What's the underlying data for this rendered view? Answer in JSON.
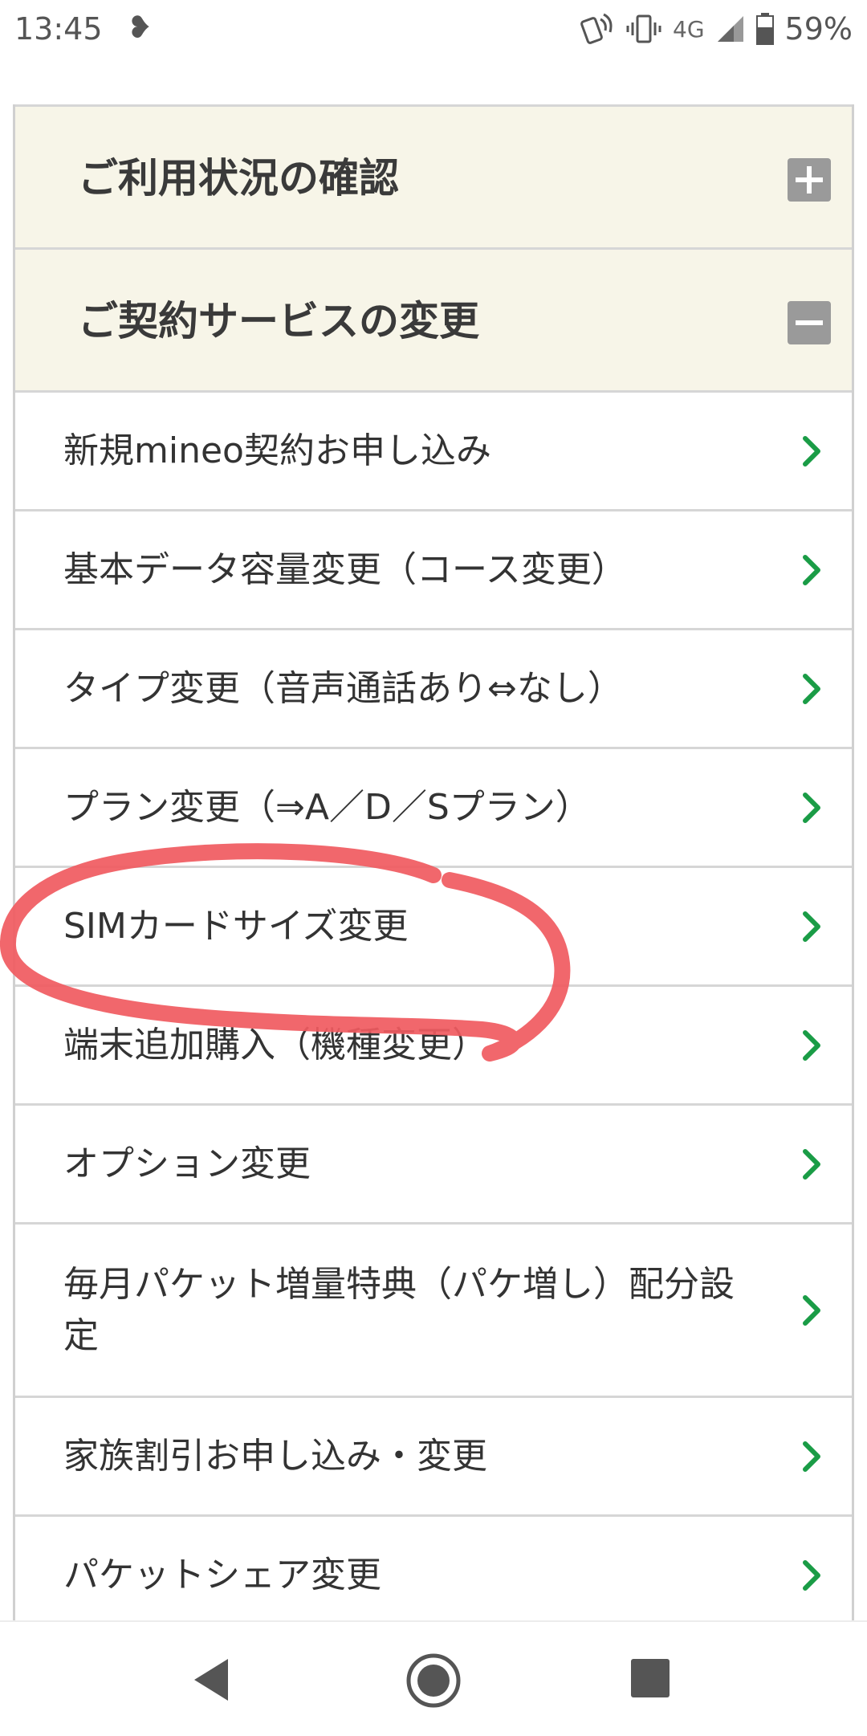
{
  "status_bar": {
    "time": "13:45",
    "network": "4G",
    "battery": "59%",
    "icons": [
      "heart-icon",
      "nfc-icon",
      "vibrate-icon",
      "signal-icon",
      "battery-icon"
    ]
  },
  "sections": [
    {
      "title": "ご利用状況の確認",
      "toggle": "expand"
    },
    {
      "title": "ご契約サービスの変更",
      "toggle": "collapse"
    }
  ],
  "menu_items": [
    "新規mineo契約お申し込み",
    "基本データ容量変更（コース変更）",
    "タイプ変更（音声通話あり⇔なし）",
    "プラン変更（⇒A／D／Sプラン）",
    "SIMカードサイズ変更",
    "端末追加購入（機種変更）",
    "オプション変更",
    "毎月パケット増量特典（パケ増し）配分設定",
    "家族割引お申し込み・変更",
    "パケットシェア変更"
  ],
  "colors": {
    "chevron": "#1a9c46",
    "section_bg": "#f7f5e8",
    "annotation": "#f05a5f",
    "toggle_bg": "#9a9a9a"
  }
}
